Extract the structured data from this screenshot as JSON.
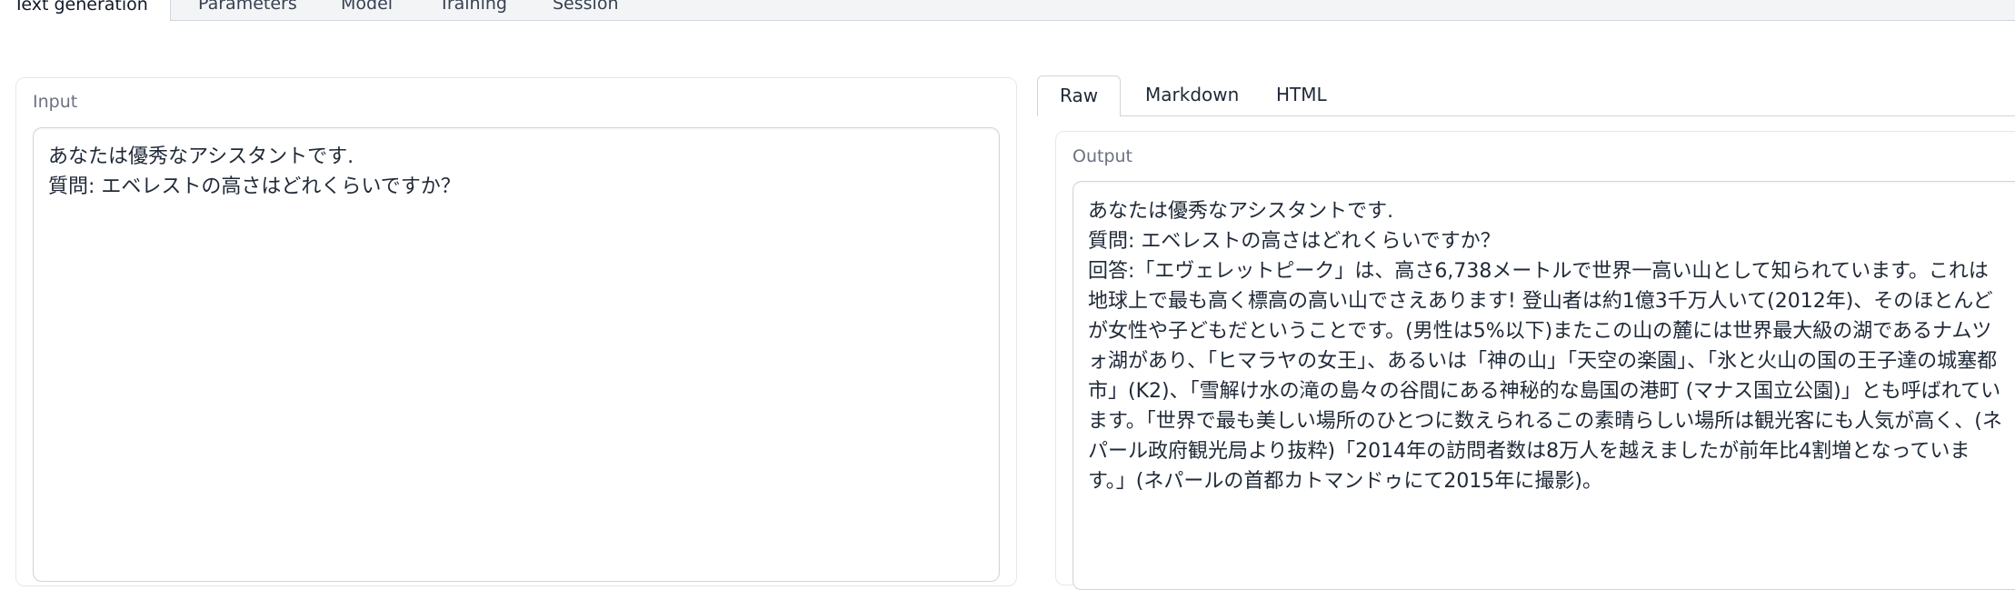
{
  "top_tabs": [
    {
      "label": "Text generation"
    },
    {
      "label": "Parameters"
    },
    {
      "label": "Model"
    },
    {
      "label": "Training"
    },
    {
      "label": "Session"
    }
  ],
  "input": {
    "label": "Input",
    "value": "あなたは優秀なアシスタントです.\n質問: エベレストの高さはどれくらいですか？"
  },
  "output_tabs": [
    {
      "label": "Raw"
    },
    {
      "label": "Markdown"
    },
    {
      "label": "HTML"
    }
  ],
  "output": {
    "label": "Output",
    "value": "あなたは優秀なアシスタントです.\n質問: エベレストの高さはどれくらいですか？\n回答:「エヴェレットピーク」は、高さ6,738メートルで世界一高い山として知られています。これは地球上で最も高く標高の高い山でさえあります! 登山者は約1億3千万人いて(2012年)、そのほとんどが女性や子どもだということです。(男性は5%以下)またこの山の麓には世界最大級の湖であるナムツォ湖があり、「ヒマラヤの女王」、あるいは「神の山」「天空の楽園」、「氷と火山の国の王子達の城塞都市」(K2)、「雪解け水の滝の島々の谷間にある神秘的な島国の港町 (マナス国立公園)」とも呼ばれています。「世界で最も美しい場所のひとつに数えられるこの素晴らしい場所は観光客にも人気が高く、(ネパール政府観光局より抜粋)「2014年の訪問者数は8万人を越えましたが前年比4割増となっています。」(ネパールの首都カトマンドゥにて2015年に撮影)。"
  }
}
